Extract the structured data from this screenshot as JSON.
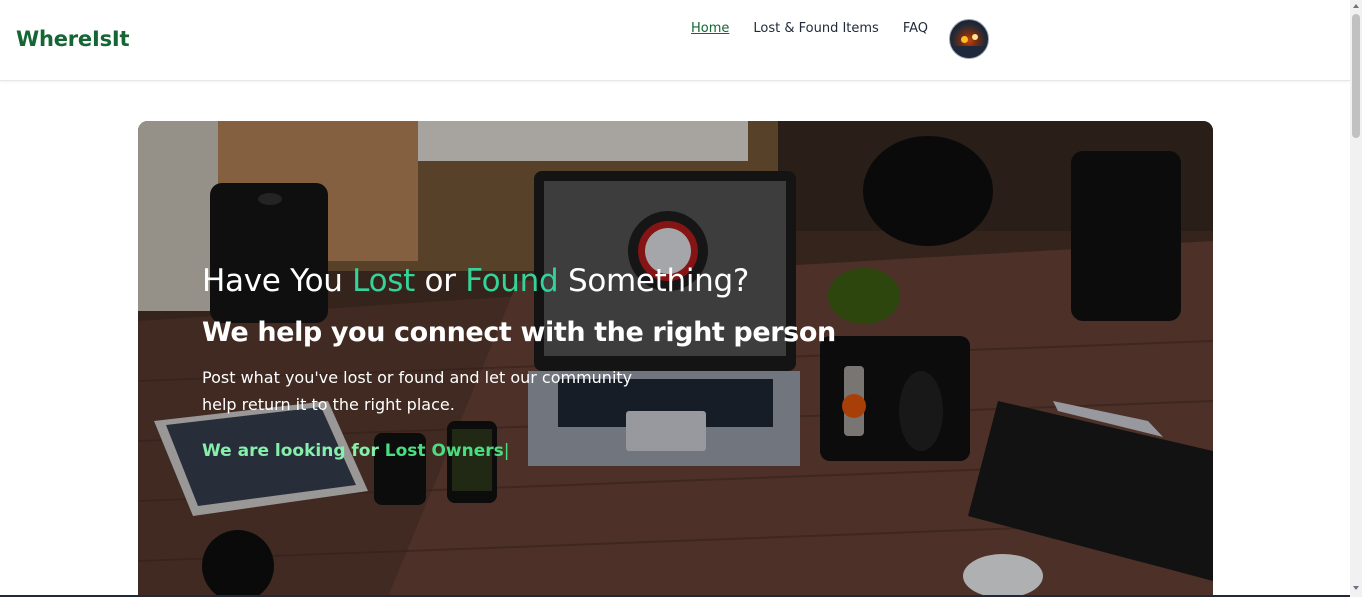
{
  "navbar": {
    "brand": "WhereIsIt",
    "links": [
      {
        "label": "Home",
        "active": true
      },
      {
        "label": "Lost & Found Items",
        "active": false
      },
      {
        "label": "FAQ",
        "active": false
      }
    ],
    "avatar_icon": "user-avatar"
  },
  "hero": {
    "headline_start": "Have You ",
    "headline_lost": "Lost",
    "headline_or": " or ",
    "headline_found": "Found",
    "headline_end": " Something?",
    "subheadline": "We help you connect with the right person",
    "description": "Post what you've lost or found and let our community help return it to the right place.",
    "typing_prefix": "We are looking for ",
    "typing_word": "Lost Owners",
    "typing_cursor": "|"
  },
  "colors": {
    "brand": "#166534",
    "accent_green": "#34d399",
    "typing_green": "#4ade80"
  }
}
